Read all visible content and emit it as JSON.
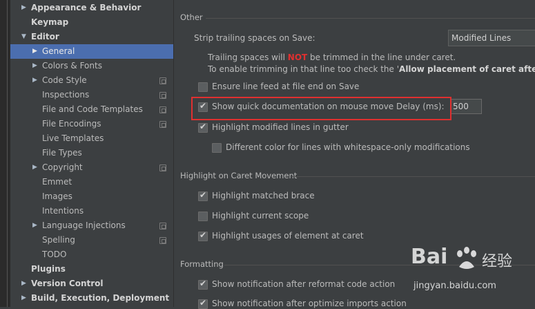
{
  "sidebar": {
    "items": [
      {
        "label": "Appearance & Behavior"
      },
      {
        "label": "Keymap"
      },
      {
        "label": "Editor"
      },
      {
        "label": "General"
      },
      {
        "label": "Colors & Fonts"
      },
      {
        "label": "Code Style"
      },
      {
        "label": "Inspections"
      },
      {
        "label": "File and Code Templates"
      },
      {
        "label": "File Encodings"
      },
      {
        "label": "Live Templates"
      },
      {
        "label": "File Types"
      },
      {
        "label": "Copyright"
      },
      {
        "label": "Emmet"
      },
      {
        "label": "Images"
      },
      {
        "label": "Intentions"
      },
      {
        "label": "Language Injections"
      },
      {
        "label": "Spelling"
      },
      {
        "label": "TODO"
      },
      {
        "label": "Plugins"
      },
      {
        "label": "Version Control"
      },
      {
        "label": "Build, Execution, Deployment"
      }
    ]
  },
  "main": {
    "other": {
      "section_title": "Other",
      "strip_label": "Strip trailing spaces on Save:",
      "strip_value": "Modified Lines",
      "note1_pre": "Trailing spaces will ",
      "note1_not": "NOT",
      "note1_post": " be trimmed in the line under caret.",
      "note2_pre": "To enable trimming in that line too check the '",
      "note2_bold": "Allow placement of caret after en",
      "ensure_line_feed": "Ensure line feed at file end on Save",
      "quick_doc": "Show quick documentation on mouse move",
      "delay_label": "Delay (ms):",
      "delay_value": "500",
      "highlight_modified": "Highlight modified lines in gutter",
      "different_color": "Different color for lines with whitespace-only modifications"
    },
    "caret": {
      "section_title": "Highlight on Caret Movement",
      "matched_brace": "Highlight matched brace",
      "current_scope": "Highlight current scope",
      "usages": "Highlight usages of element at caret"
    },
    "formatting": {
      "section_title": "Formatting",
      "reformat": "Show notification after reformat code action",
      "optimize": "Show notification after optimize imports action"
    }
  },
  "watermark": {
    "brand_left": "Bai",
    "brand_right": "经验",
    "url": "jingyan.baidu.com"
  }
}
